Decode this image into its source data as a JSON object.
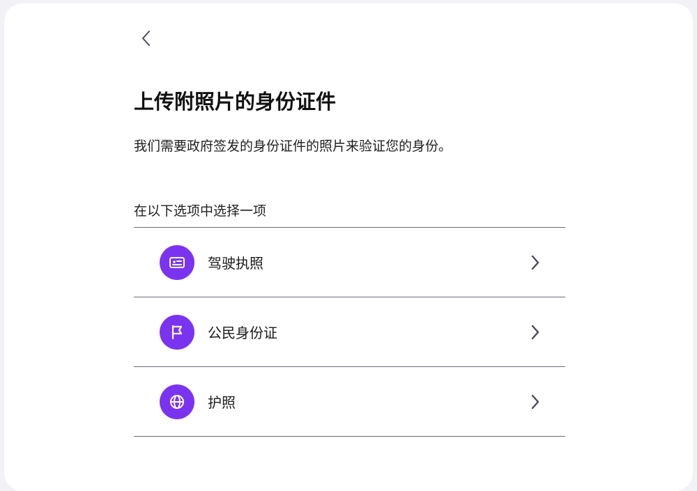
{
  "header": {
    "title": "上传附照片的身份证件",
    "subtitle": "我们需要政府签发的身份证件的照片来验证您的身份。"
  },
  "section": {
    "label": "在以下选项中选择一项"
  },
  "options": [
    {
      "label": "驾驶执照",
      "icon": "id-card-icon"
    },
    {
      "label": "公民身份证",
      "icon": "flag-icon"
    },
    {
      "label": "护照",
      "icon": "globe-icon"
    }
  ],
  "colors": {
    "accent": "#7a34f0",
    "divider": "#6b6b78",
    "chevron": "#4a4a58",
    "background": "#f2f2f6"
  }
}
